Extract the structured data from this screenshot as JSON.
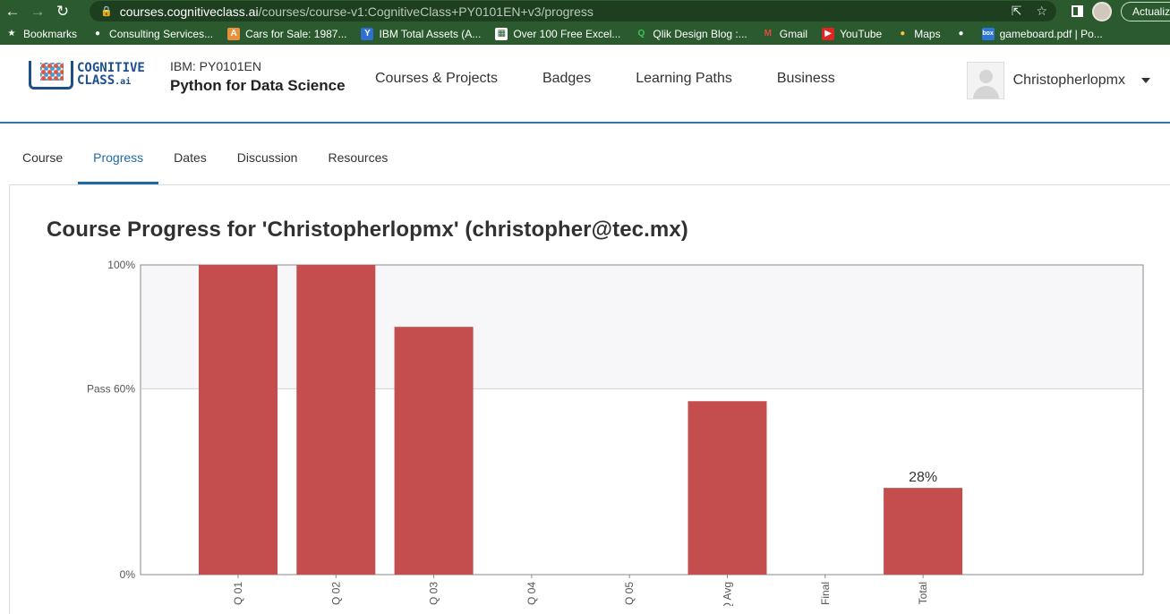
{
  "browser": {
    "url_host": "courses.cognitiveclass.ai",
    "url_path": "/courses/course-v1:CognitiveClass+PY0101EN+v3/progress",
    "update_label": "Actualiz",
    "bookmarks": [
      {
        "label": "Bookmarks",
        "icon": "star-icon"
      },
      {
        "label": "Consulting Services...",
        "icon": "globe-icon"
      },
      {
        "label": "Cars for Sale: 1987...",
        "icon": "cars-icon"
      },
      {
        "label": "IBM Total Assets (A...",
        "icon": "yahoo-icon"
      },
      {
        "label": "Over 100 Free Excel...",
        "icon": "excel-icon"
      },
      {
        "label": "Qlik Design Blog :...",
        "icon": "qlik-icon"
      },
      {
        "label": "Gmail",
        "icon": "gmail-icon"
      },
      {
        "label": "YouTube",
        "icon": "youtube-icon"
      },
      {
        "label": "Maps",
        "icon": "maps-icon"
      },
      {
        "label": "",
        "icon": "globe-icon"
      },
      {
        "label": "gameboard.pdf | Po...",
        "icon": "box-icon"
      }
    ]
  },
  "header": {
    "logo_line1": "COGNITIVE",
    "logo_line2": "CLASS",
    "logo_suffix": ".ai",
    "course_code": "IBM: PY0101EN",
    "course_name": "Python for Data Science",
    "nav": [
      "Courses & Projects",
      "Badges",
      "Learning Paths",
      "Business"
    ],
    "username": "Christopherlopmx"
  },
  "tabs": [
    {
      "label": "Course",
      "active": false
    },
    {
      "label": "Progress",
      "active": true
    },
    {
      "label": "Dates",
      "active": false
    },
    {
      "label": "Discussion",
      "active": false
    },
    {
      "label": "Resources",
      "active": false
    }
  ],
  "page": {
    "title": "Course Progress for 'Christopherlopmx' (christopher@tec.mx)"
  },
  "colors": {
    "bar": "#c44d4d",
    "pass_band": "#f7f7fa",
    "accent": "#1f6aa5"
  },
  "chart_data": {
    "type": "bar",
    "categories": [
      "Q 01",
      "Q 02",
      "Q 03",
      "Q 04",
      "Q 05",
      "RQ Avg",
      "Final",
      "Total"
    ],
    "values": [
      100,
      100,
      80,
      0,
      0,
      56,
      0,
      28
    ],
    "ylim": [
      0,
      100
    ],
    "yticks": [
      {
        "value": 100,
        "label": "100%"
      },
      {
        "value": 60,
        "label": "Pass 60%"
      },
      {
        "value": 0,
        "label": "0%"
      }
    ],
    "pass_threshold": 60,
    "data_labels": {
      "Total": "28%"
    }
  }
}
